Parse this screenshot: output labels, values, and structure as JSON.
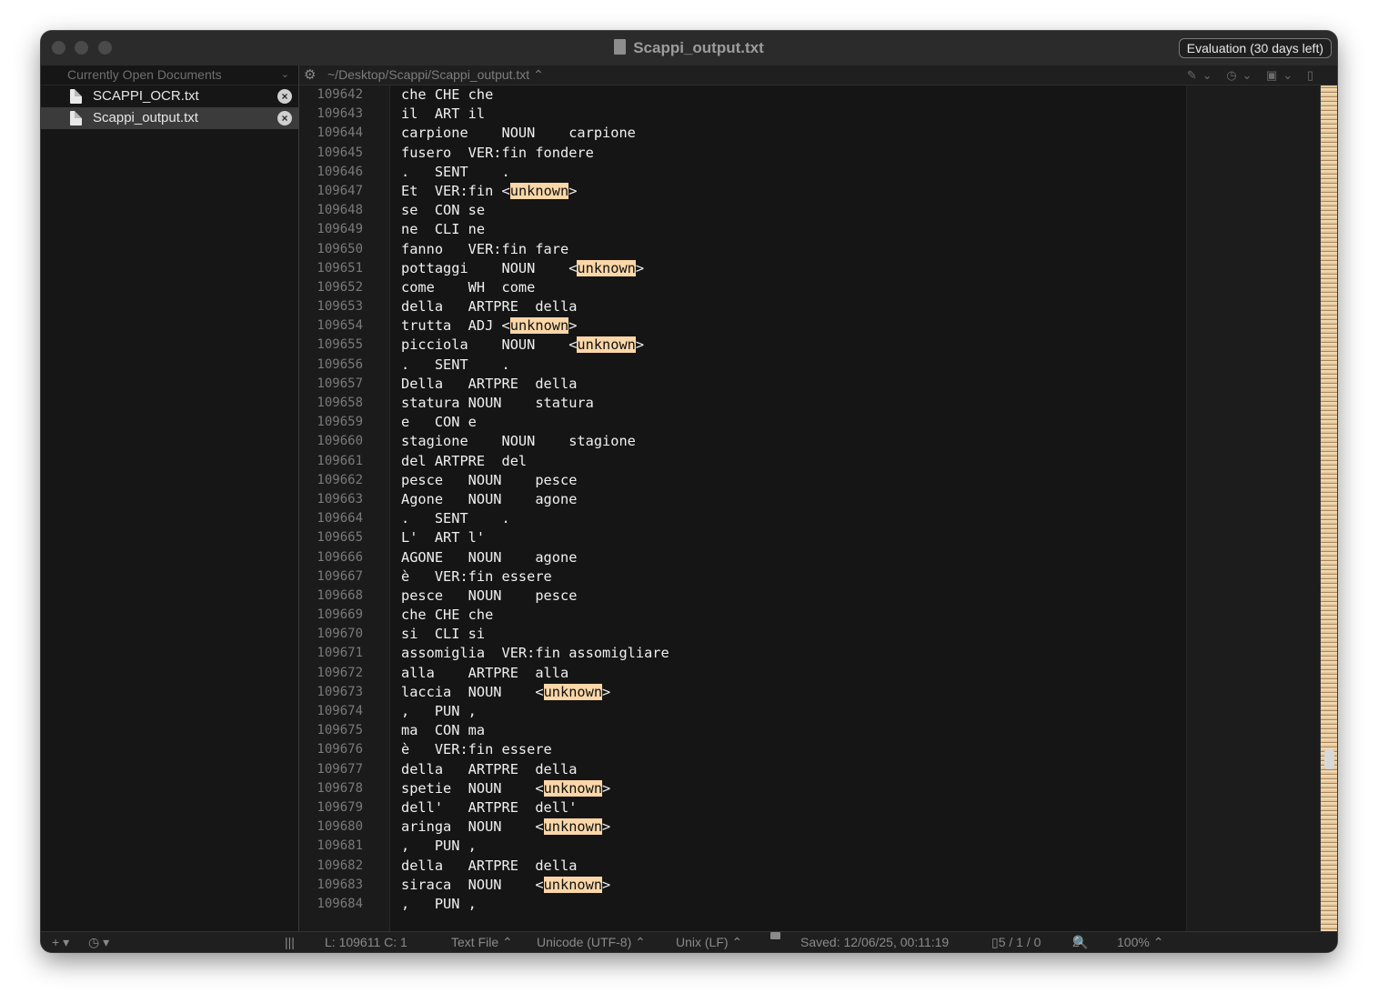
{
  "window": {
    "title": "Scappi_output.txt",
    "evaluation_badge": "Evaluation (30 days left)"
  },
  "sidebar": {
    "header": "Currently Open Documents",
    "documents": [
      {
        "name": "SCAPPI_OCR.txt"
      },
      {
        "name": "Scappi_output.txt"
      }
    ]
  },
  "pathbar": {
    "path": "~/Desktop/Scappi/Scappi_output.txt"
  },
  "editor": {
    "highlight_color": "#fbd7a8",
    "lines": [
      {
        "n": "109642",
        "text": "che CHE che"
      },
      {
        "n": "109643",
        "text": "il  ART il"
      },
      {
        "n": "109644",
        "text": "carpione    NOUN    carpione"
      },
      {
        "n": "109645",
        "text": "fusero  VER:fin fondere"
      },
      {
        "n": "109646",
        "text": ".   SENT    ."
      },
      {
        "n": "109647",
        "text": "Et  VER:fin <",
        "hl": "unknown",
        "after": ">"
      },
      {
        "n": "109648",
        "text": "se  CON se"
      },
      {
        "n": "109649",
        "text": "ne  CLI ne"
      },
      {
        "n": "109650",
        "text": "fanno   VER:fin fare"
      },
      {
        "n": "109651",
        "text": "pottaggi    NOUN    <",
        "hl": "unknown",
        "after": ">"
      },
      {
        "n": "109652",
        "text": "come    WH  come"
      },
      {
        "n": "109653",
        "text": "della   ARTPRE  della"
      },
      {
        "n": "109654",
        "text": "trutta  ADJ <",
        "hl": "unknown",
        "after": ">"
      },
      {
        "n": "109655",
        "text": "picciola    NOUN    <",
        "hl": "unknown",
        "after": ">"
      },
      {
        "n": "109656",
        "text": ".   SENT    ."
      },
      {
        "n": "109657",
        "text": "Della   ARTPRE  della"
      },
      {
        "n": "109658",
        "text": "statura NOUN    statura"
      },
      {
        "n": "109659",
        "text": "e   CON e"
      },
      {
        "n": "109660",
        "text": "stagione    NOUN    stagione"
      },
      {
        "n": "109661",
        "text": "del ARTPRE  del"
      },
      {
        "n": "109662",
        "text": "pesce   NOUN    pesce"
      },
      {
        "n": "109663",
        "text": "Agone   NOUN    agone"
      },
      {
        "n": "109664",
        "text": ".   SENT    ."
      },
      {
        "n": "109665",
        "text": "L'  ART l'"
      },
      {
        "n": "109666",
        "text": "AGONE   NOUN    agone"
      },
      {
        "n": "109667",
        "text": "è   VER:fin essere"
      },
      {
        "n": "109668",
        "text": "pesce   NOUN    pesce"
      },
      {
        "n": "109669",
        "text": "che CHE che"
      },
      {
        "n": "109670",
        "text": "si  CLI si"
      },
      {
        "n": "109671",
        "text": "assomiglia  VER:fin assomigliare"
      },
      {
        "n": "109672",
        "text": "alla    ARTPRE  alla"
      },
      {
        "n": "109673",
        "text": "laccia  NOUN    <",
        "hl": "unknown",
        "after": ">"
      },
      {
        "n": "109674",
        "text": ",   PUN ,"
      },
      {
        "n": "109675",
        "text": "ma  CON ma"
      },
      {
        "n": "109676",
        "text": "è   VER:fin essere"
      },
      {
        "n": "109677",
        "text": "della   ARTPRE  della"
      },
      {
        "n": "109678",
        "text": "spetie  NOUN    <",
        "hl": "unknown",
        "after": ">"
      },
      {
        "n": "109679",
        "text": "dell'   ARTPRE  dell'"
      },
      {
        "n": "109680",
        "text": "aringa  NOUN    <",
        "hl": "unknown",
        "after": ">"
      },
      {
        "n": "109681",
        "text": ",   PUN ,"
      },
      {
        "n": "109682",
        "text": "della   ARTPRE  della"
      },
      {
        "n": "109683",
        "text": "siraca  NOUN    <",
        "hl": "unknown",
        "after": ">"
      },
      {
        "n": "109684",
        "text": ",   PUN ,"
      }
    ]
  },
  "statusbar": {
    "add": "+ ▾",
    "clock": "◷ ▾",
    "columns": "|||",
    "position": "L: 109611 C: 1",
    "file_type": "Text File ⌃",
    "encoding": "Unicode (UTF-8) ⌃",
    "line_endings": "Unix (LF) ⌃",
    "saved": "Saved: 12/06/25, 00:11:19",
    "counts": "5 / 1 / 0",
    "zoom_steps": "2",
    "zoom": "100% ⌃"
  }
}
